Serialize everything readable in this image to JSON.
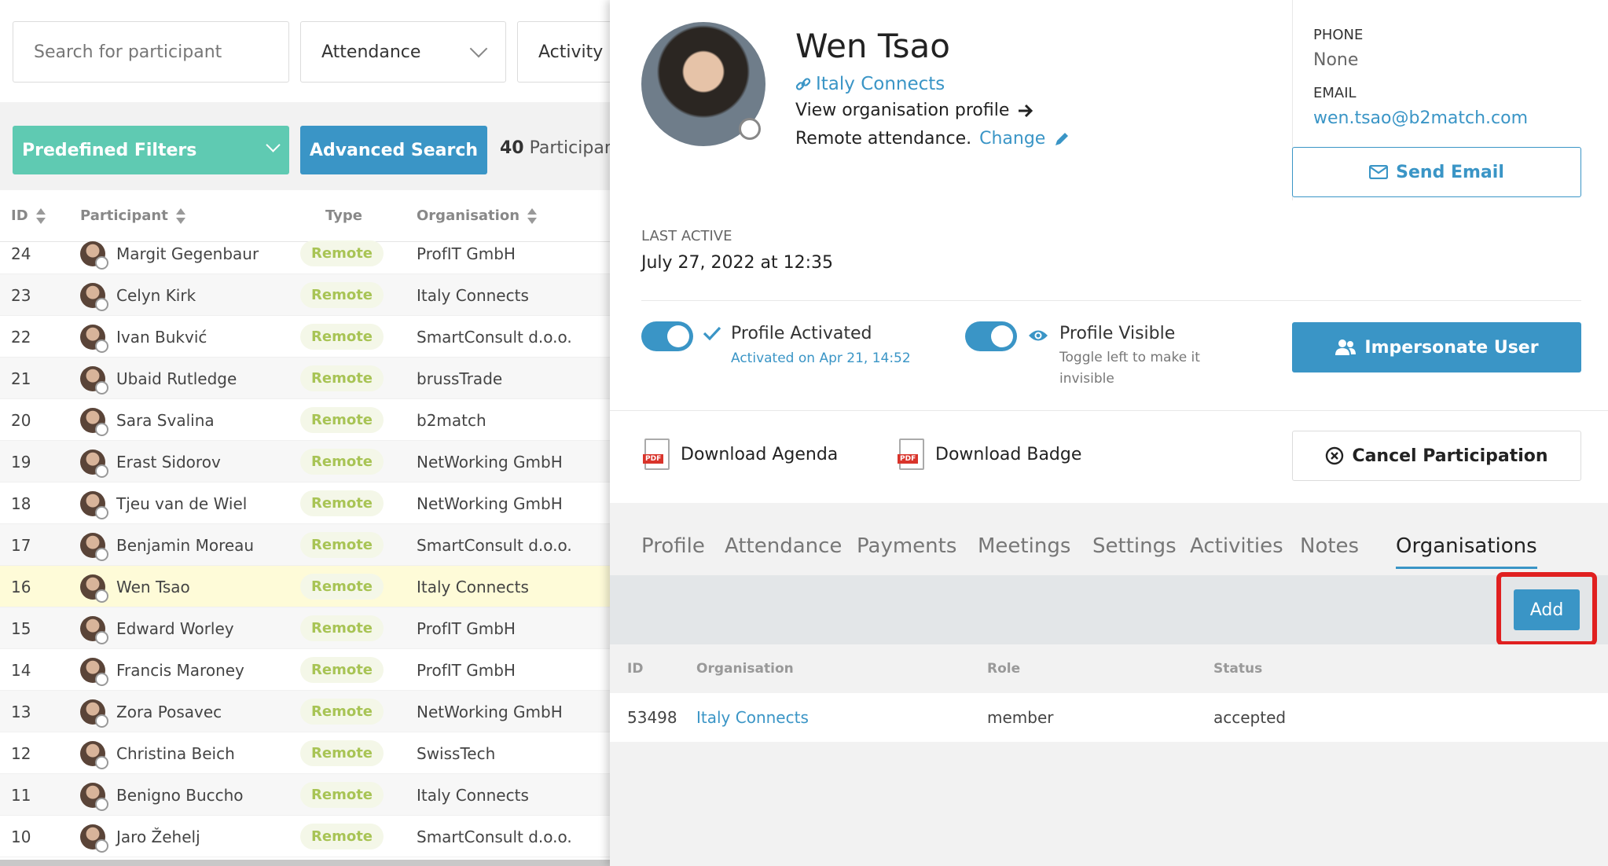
{
  "search": {
    "placeholder": "Search for participant"
  },
  "filters": {
    "attendance": "Attendance",
    "activity": "Activity"
  },
  "toolbar": {
    "predefined_filters": "Predefined Filters",
    "advanced_search": "Advanced Search",
    "count_number": "40",
    "count_label": "Participan"
  },
  "table": {
    "headers": {
      "id": "ID",
      "participant": "Participant",
      "type": "Type",
      "organisation": "Organisation"
    },
    "rows": [
      {
        "id": "24",
        "name": "Margit Gegenbaur",
        "type": "Remote",
        "org": "ProfIT GmbH"
      },
      {
        "id": "23",
        "name": "Celyn Kirk",
        "type": "Remote",
        "org": "Italy Connects"
      },
      {
        "id": "22",
        "name": "Ivan Bukvić",
        "type": "Remote",
        "org": "SmartConsult d.o.o."
      },
      {
        "id": "21",
        "name": "Ubaid Rutledge",
        "type": "Remote",
        "org": "brussTrade"
      },
      {
        "id": "20",
        "name": "Sara Svalina",
        "type": "Remote",
        "org": "b2match"
      },
      {
        "id": "19",
        "name": "Erast Sidorov",
        "type": "Remote",
        "org": "NetWorking GmbH"
      },
      {
        "id": "18",
        "name": "Tjeu van de Wiel",
        "type": "Remote",
        "org": "NetWorking GmbH"
      },
      {
        "id": "17",
        "name": "Benjamin Moreau",
        "type": "Remote",
        "org": "SmartConsult d.o.o."
      },
      {
        "id": "16",
        "name": "Wen Tsao",
        "type": "Remote",
        "org": "Italy Connects"
      },
      {
        "id": "15",
        "name": "Edward Worley",
        "type": "Remote",
        "org": "ProfIT GmbH"
      },
      {
        "id": "14",
        "name": "Francis Maroney",
        "type": "Remote",
        "org": "ProfIT GmbH"
      },
      {
        "id": "13",
        "name": "Zora Posavec",
        "type": "Remote",
        "org": "NetWorking GmbH"
      },
      {
        "id": "12",
        "name": "Christina Beich",
        "type": "Remote",
        "org": "SwissTech"
      },
      {
        "id": "11",
        "name": "Benigno Buccho",
        "type": "Remote",
        "org": "Italy Connects"
      },
      {
        "id": "10",
        "name": "Jaro Žehelj",
        "type": "Remote",
        "org": "SmartConsult d.o.o."
      }
    ]
  },
  "profile": {
    "name": "Wen Tsao",
    "organisation": "Italy Connects",
    "view_org": "View organisation profile",
    "attendance": "Remote attendance.",
    "change": "Change",
    "phone_label": "PHONE",
    "phone": "None",
    "email_label": "EMAIL",
    "email": "wen.tsao@b2match.com",
    "send_email": "Send Email",
    "last_active_label": "LAST ACTIVE",
    "last_active": "July 27, 2022 at 12:35",
    "activated_label": "Profile Activated",
    "activated_sub": "Activated on Apr 21, 14:52",
    "visible_label": "Profile Visible",
    "visible_sub": "Toggle left to make it invisible",
    "impersonate": "Impersonate User",
    "download_agenda": "Download Agenda",
    "download_badge": "Download Badge",
    "cancel": "Cancel Participation"
  },
  "tabs": [
    "Profile",
    "Attendance",
    "Payments",
    "Meetings",
    "Settings",
    "Activities",
    "Notes",
    "Organisations"
  ],
  "orgs": {
    "add": "Add",
    "headers": {
      "id": "ID",
      "organisation": "Organisation",
      "role": "Role",
      "status": "Status"
    },
    "rows": [
      {
        "id": "53498",
        "organisation": "Italy Connects",
        "role": "member",
        "status": "accepted"
      }
    ]
  },
  "colors": {
    "accent": "#3a95c6",
    "green": "#5fcab2",
    "highlight": "#e02020"
  }
}
